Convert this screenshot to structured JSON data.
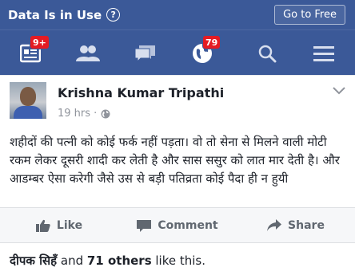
{
  "topbar": {
    "data_label": "Data Is in Use",
    "help": "?",
    "go_free_label": "Go to Free"
  },
  "nav": {
    "feed_badge": "9+",
    "notifications_badge": "79"
  },
  "post": {
    "author": "Krishna Kumar Tripathi",
    "time": "19 hrs ·",
    "text": "शहीदों की पत्नी को कोई फर्क नहीं पड़ता। वो तो सेना से मिलने वाली मोटी रकम लेकर दूसरी शादी कर लेती है और सास ससुर को लात मार देती है। और आडम्बर ऐसा करेगी जैसे उस से बड़ी पतिव्रता कोई पैदा ही न हुयी",
    "actions": {
      "like": "Like",
      "comment": "Comment",
      "share": "Share"
    },
    "likes": {
      "first_name": "दीपक सिहँ",
      "and": " and ",
      "others": "71 others",
      "suffix": " like this."
    }
  },
  "colors": {
    "brand": "#3b5998",
    "badge": "#e41b23",
    "muted": "#90949c"
  }
}
